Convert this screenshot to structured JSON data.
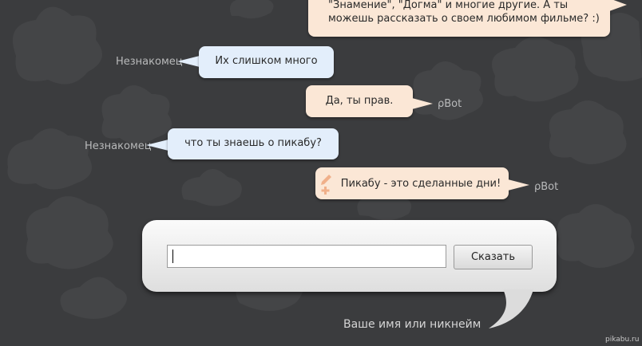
{
  "chat": {
    "messages": [
      {
        "from": "bot",
        "text": "\"Знамение\", \"Догма\" и многие другие. А ты можешь рассказать о своем любимом фильме? :)"
      },
      {
        "from": "user",
        "sender": "Незнакомец",
        "text": "Их слишком много"
      },
      {
        "from": "bot",
        "sender": "ρBot",
        "text": "Да, ты прав."
      },
      {
        "from": "user",
        "sender": "Незнакомец",
        "text": "что ты знаешь о пикабу?"
      },
      {
        "from": "bot",
        "sender": "ρBot",
        "text": "Пикабу - это сделанные дни!"
      }
    ]
  },
  "input_panel": {
    "input_value": "",
    "say_button_label": "Сказать",
    "name_label": "Ваше имя или никнейм"
  },
  "watermark": "pikabu.ru",
  "colors": {
    "background": "#3b3c3e",
    "user_bubble": "#e3eefb",
    "bot_bubble": "#fbe7d6",
    "panel": "#eeeeee"
  },
  "icons": {
    "last_bot_message": "pencil-plus-icon"
  }
}
